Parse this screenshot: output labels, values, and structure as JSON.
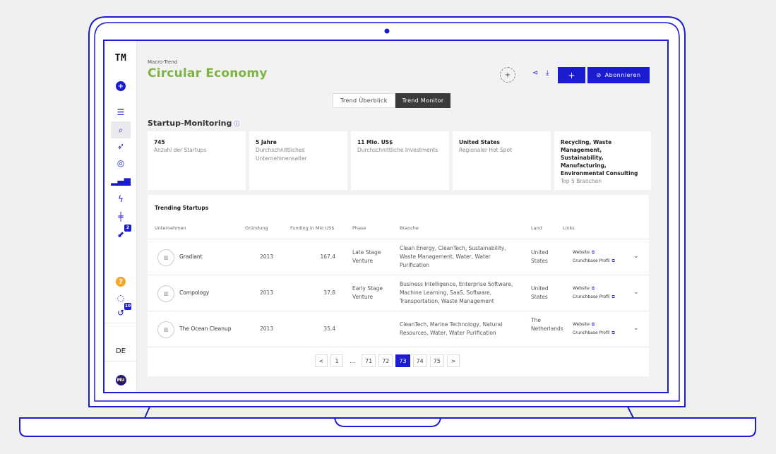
{
  "sidebar": {
    "logo": "TM",
    "lang": "DE",
    "avatar": "MU",
    "badge_inbox": "2",
    "badge_history": "10",
    "icons": [
      "add-circle-icon",
      "list-icon",
      "search-icon",
      "rocket-icon",
      "target-icon",
      "bar-chart-icon",
      "bolt-icon",
      "signpost-icon",
      "chart-arrow-icon",
      "help-icon",
      "chat-icon",
      "history-icon"
    ]
  },
  "header": {
    "kicker": "Macro-Trend",
    "title": "Circular Economy",
    "circle_plus": "+",
    "plus_label": "+",
    "subscribe_label": "Abonnieren",
    "title_color": "#7cb342",
    "accent": "#1b1ccf"
  },
  "tabs": {
    "overview": "Trend Überblick",
    "monitor": "Trend Monitor"
  },
  "section": {
    "title": "Startup-Monitoring",
    "info": "ⓘ"
  },
  "kpis": [
    {
      "value": "745",
      "label": "Anzahl der Startups"
    },
    {
      "value": "5 Jahre",
      "label": "Durchschnittliches Unternehmensalter"
    },
    {
      "value": "11 Mio. US$",
      "label": "Durchschnittliche Investments"
    },
    {
      "value": "United States",
      "label": "Regionaler Hot Spot"
    },
    {
      "value": "Recycling, Waste Management, Sustainability, Manufacturing, Environmental Consulting",
      "label": "Top 5 Branchen"
    }
  ],
  "table": {
    "title": "Trending Startups",
    "headers": {
      "company": "Unternehmen",
      "founded": "Gründung",
      "funding": "Funding in Mio US$",
      "phase": "Phase",
      "branch": "Branche",
      "country": "Land",
      "links": "Links"
    },
    "rows": [
      {
        "name": "Gradiant",
        "founded": "2013",
        "funding": "167,4",
        "phase": "Late Stage Venture",
        "branch": "Clean Energy, CleanTech, Sustainability, Waste Management, Water, Water Purification",
        "country": "United States",
        "website": "Website",
        "crunchbase": "Crunchbase Profil"
      },
      {
        "name": "Compology",
        "founded": "2013",
        "funding": "37,8",
        "phase": "Early Stage Venture",
        "branch": "Business Intelligence, Enterprise Software, Machine Learning, SaaS, Software, Transportation, Waste Management",
        "country": "United States",
        "website": "Website",
        "crunchbase": "Crunchbase Profil"
      },
      {
        "name": "The Ocean Cleanup",
        "founded": "2013",
        "funding": "35,4",
        "phase": "",
        "branch": "CleanTech, Marine Technology, Natural Resources, Water, Water Purification",
        "country": "The Netherlands",
        "website": "Website",
        "crunchbase": "Crunchbase Profil"
      }
    ]
  },
  "pager": {
    "prev": "<",
    "first": "1",
    "dots": "...",
    "pages": [
      "71",
      "72",
      "73",
      "74",
      "75"
    ],
    "current": "73",
    "next": ">"
  }
}
